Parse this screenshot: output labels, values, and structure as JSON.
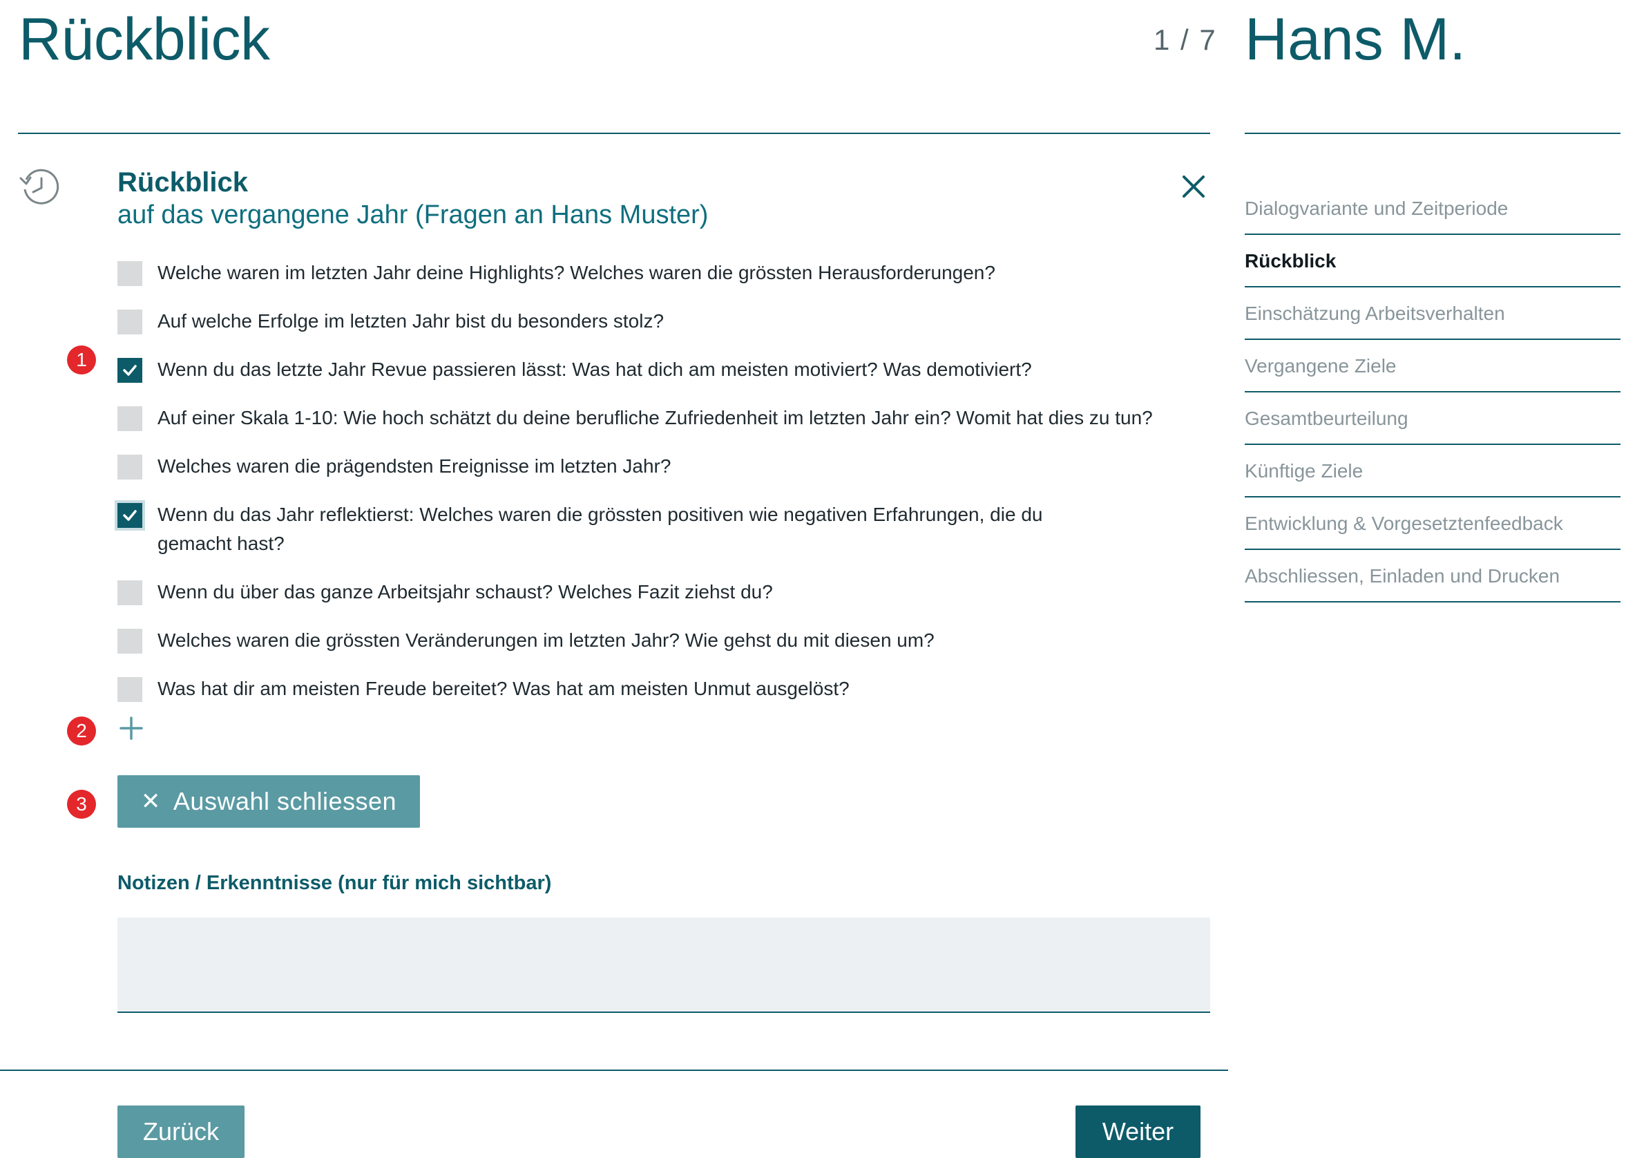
{
  "header": {
    "title": "Rückblick",
    "counter": "1 / 7",
    "person": "Hans M."
  },
  "section": {
    "icon": "history-icon",
    "title": "Rückblick",
    "subtitle": "auf das vergangene Jahr (Fragen an Hans Muster)",
    "close_icon": "close-icon"
  },
  "questions": [
    {
      "text": "Welche waren im letzten Jahr deine Highlights? Welches waren die grössten Herausforderungen?",
      "checked": false
    },
    {
      "text": "Auf welche Erfolge im letzten Jahr bist du besonders stolz?",
      "checked": false
    },
    {
      "text": "Wenn du das letzte Jahr Revue passieren lässt: Was hat dich am meisten motiviert? Was demotiviert?",
      "checked": true
    },
    {
      "text": "Auf einer Skala 1-10: Wie hoch schätzt du deine berufliche Zufriedenheit im letzten Jahr ein? Womit hat dies zu tun?",
      "checked": false
    },
    {
      "text": "Welches waren die prägendsten Ereignisse im letzten Jahr?",
      "checked": false
    },
    {
      "text": "Wenn du das Jahr reflektierst: Welches waren die grössten positiven wie negativen Erfahrungen, die du gemacht hast?",
      "checked": true
    },
    {
      "text": "Wenn du über das ganze Arbeitsjahr schaust? Welches Fazit ziehst du?",
      "checked": false
    },
    {
      "text": "Welches waren die grössten Veränderungen im letzten Jahr? Wie gehst du mit diesen um?",
      "checked": false
    },
    {
      "text": "Was hat dir am meisten Freude bereitet? Was hat am meisten Unmut ausgelöst?",
      "checked": false
    }
  ],
  "badges": [
    "1",
    "2",
    "3"
  ],
  "add_icon": "plus-icon",
  "close_selection": {
    "icon": "x-icon",
    "label": "Auswahl schliessen"
  },
  "notes": {
    "label": "Notizen / Erkenntnisse (nur für mich sichtbar)",
    "value": ""
  },
  "footer": {
    "back": "Zurück",
    "next": "Weiter"
  },
  "nav": [
    {
      "label": "Dialogvariante und Zeitperiode",
      "active": false
    },
    {
      "label": "Rückblick",
      "active": true
    },
    {
      "label": "Einschätzung Arbeitsverhalten",
      "active": false
    },
    {
      "label": "Vergangene Ziele",
      "active": false
    },
    {
      "label": "Gesamtbeurteilung",
      "active": false
    },
    {
      "label": "Künftige Ziele",
      "active": false
    },
    {
      "label": "Entwicklung & Vorgesetztenfeedback",
      "active": false
    },
    {
      "label": "Abschliessen, Einladen und Drucken",
      "active": false
    }
  ],
  "colors": {
    "primary": "#0d5b69",
    "button_muted": "#5a9aa3",
    "badge": "#e3272b",
    "checkbox_unchecked": "#d8dadb",
    "notes_bg": "#ecf0f2"
  }
}
